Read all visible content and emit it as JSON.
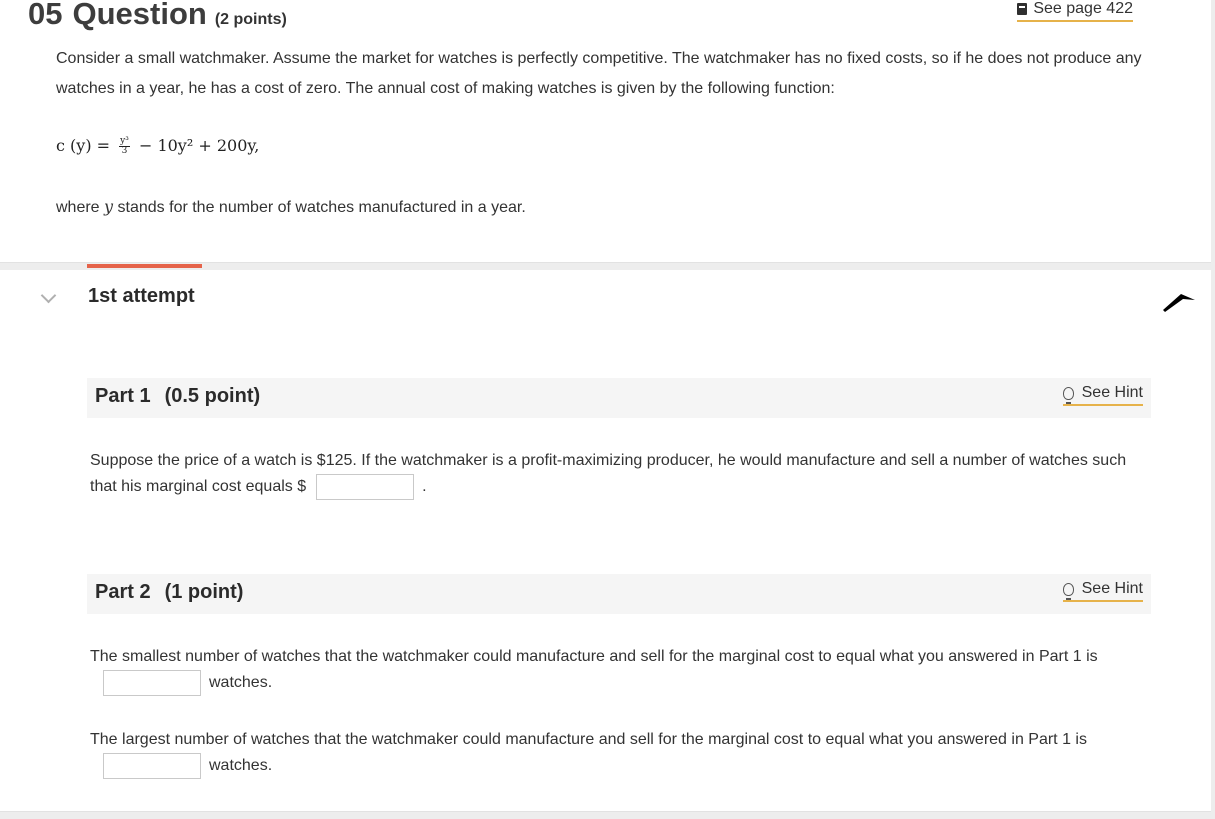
{
  "question": {
    "number": "05",
    "word": "Question",
    "points": "(2 points)",
    "see_page": "See page 422",
    "intro": "Consider a small watchmaker. Assume the market for watches is perfectly competitive. The watchmaker has no fixed costs, so if he does not produce any watches in a year, he has a cost of zero. The annual cost of making watches is given by the following function:",
    "formula_lhs": "c (y) =",
    "formula_frac_num": "y³",
    "formula_frac_den": "3",
    "formula_rhs": "− 10y² + 200y,",
    "where_prefix": "where",
    "where_var": "y",
    "where_suffix": "stands for the number of watches manufactured in a year."
  },
  "attempt": {
    "title": "1st attempt"
  },
  "part1": {
    "title": "Part 1",
    "points": "(0.5 point)",
    "hint": "See Hint",
    "text_before": "Suppose the price of a watch is $125. If the watchmaker is a profit-maximizing producer, he would manufacture and sell a number of watches such that his marginal cost equals $",
    "text_after": ".",
    "answer": ""
  },
  "part2": {
    "title": "Part 2",
    "points": "(1 point)",
    "hint": "See Hint",
    "q1_before": "The smallest number of watches that the watchmaker could manufacture and sell for the marginal cost to equal what you answered in Part 1 is",
    "q1_after": "watches.",
    "q1_answer": "",
    "q2_before": "The largest number of watches that the watchmaker could manufacture and sell for the marginal cost to equal what you answered in Part 1 is",
    "q2_after": "watches.",
    "q2_answer": ""
  },
  "colors": {
    "accent_bar": "#e5634a",
    "link_underline": "#e6b24a"
  }
}
